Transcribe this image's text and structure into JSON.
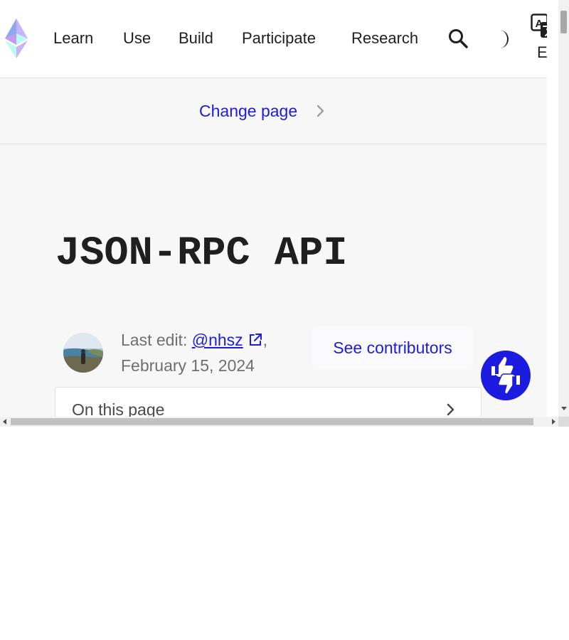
{
  "nav": {
    "links": [
      "Learn",
      "Use",
      "Build",
      "Participate",
      "Research"
    ],
    "language": "EN"
  },
  "change_page": {
    "label": "Change page"
  },
  "page": {
    "title": "JSON-RPC API"
  },
  "meta": {
    "last_edit_prefix": "Last edit:",
    "author": "@nhsz",
    "date": "February 15, 2024",
    "contributors_button": "See contributors"
  },
  "toc": {
    "label": "On this page"
  },
  "colors": {
    "accent": "#1c1ce1",
    "page_bg": "#f7f7f7"
  },
  "icons": [
    "ethereum-logo-icon",
    "search-icon",
    "dark-mode-icon",
    "translate-icon",
    "chevron-right-icon",
    "external-link-icon",
    "feedback-thumbs-icon"
  ]
}
